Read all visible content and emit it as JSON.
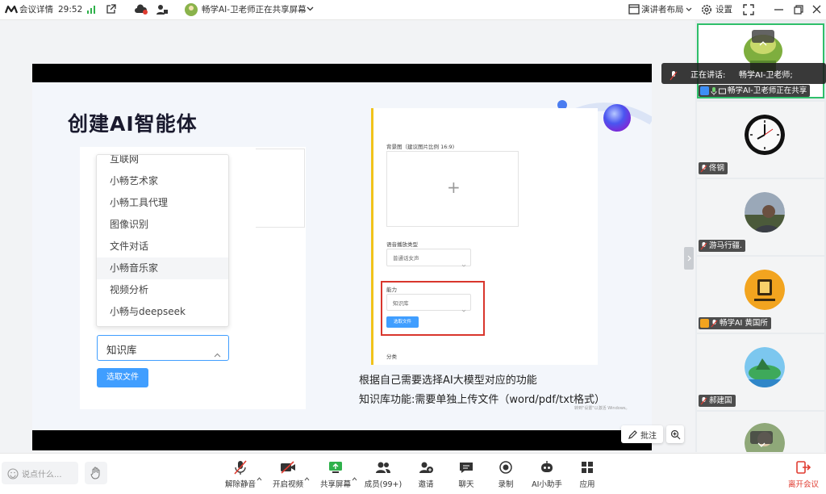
{
  "topbar": {
    "meeting_details": "会议详情",
    "timer": "29:52",
    "sharing_status": "畅学AI-卫老师正在共享屏幕",
    "layout_label": "演讲者布局",
    "settings_label": "设置"
  },
  "slide": {
    "title": "创建AI智能体",
    "menu_items": [
      "互联网",
      "小畅艺术家",
      "小畅工具代理",
      "图像识别",
      "文件对话",
      "小畅音乐家",
      "视频分析",
      "小畅与deepseek"
    ],
    "knowledge_select": "知识库",
    "select_file_btn": "选取文件",
    "bg_image_label": "背景图（建议图片比例 16:9)",
    "plus": "+",
    "voice_type_label": "语音播放类型",
    "voice_type_value": "普通话女声",
    "ability_label": "能力",
    "ability_value": "知识库",
    "small_select_file": "选取文件",
    "category_label": "分类",
    "caption_line1": "根据自己需要选择AI大模型对应的功能",
    "caption_line2": "知识库功能:需要单独上传文件（word/pdf/txt格式）",
    "watermark": "转到\"设置\"以激活 Windows。"
  },
  "share_tools": {
    "annotate_label": "批注"
  },
  "speaking": {
    "label": "正在讲话:",
    "name": "畅学AI-卫老师;"
  },
  "participants": [
    {
      "name": "畅学AI-卫老师正在共享"
    },
    {
      "name": "佟钢"
    },
    {
      "name": "游马行疆."
    },
    {
      "name": "畅学AI  黄国所"
    },
    {
      "name": "郝建国"
    }
  ],
  "bottombar": {
    "chat_placeholder": "说点什么...",
    "tools": [
      {
        "label": "解除静音"
      },
      {
        "label": "开启视频"
      },
      {
        "label": "共享屏幕"
      },
      {
        "label": "成员(99+)"
      },
      {
        "label": "邀请"
      },
      {
        "label": "聊天"
      },
      {
        "label": "录制"
      },
      {
        "label": "AI小助手"
      },
      {
        "label": "应用"
      }
    ],
    "leave_label": "离开会议"
  },
  "colors": {
    "accent_blue": "#3d8ef5",
    "leave_red": "#e03c31",
    "highlight_red": "#d9362d",
    "sidebar_active_border": "#2fbf6a"
  }
}
